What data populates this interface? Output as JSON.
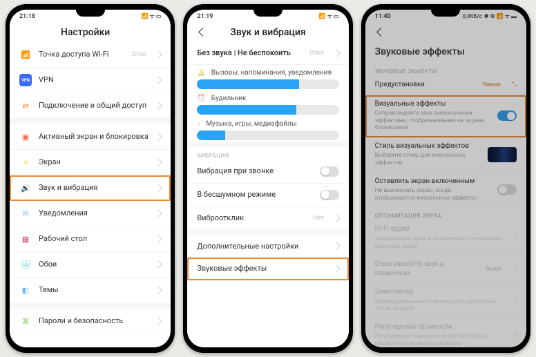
{
  "phone1": {
    "time": "21:18",
    "title": "Настройки",
    "items": [
      {
        "icon": "📶",
        "iconColor": "#f7b733",
        "label": "Точка доступа Wi-Fi",
        "value": "Откл"
      },
      {
        "icon": "VPN",
        "iconColor": "#3b6bff",
        "label": "VPN"
      },
      {
        "icon": "⇄",
        "iconColor": "#ff8c3b",
        "label": "Подключение и общий доступ"
      }
    ],
    "items2": [
      {
        "icon": "▣",
        "iconColor": "#ff6b4a",
        "label": "Активный экран и блокировка"
      },
      {
        "icon": "☀",
        "iconColor": "#ffd24a",
        "label": "Экран"
      },
      {
        "icon": "🔊",
        "iconColor": "#34c759",
        "label": "Звук и вибрация",
        "hl": true
      },
      {
        "icon": "✉",
        "iconColor": "#6ec4ff",
        "label": "Уведомления"
      },
      {
        "icon": "▦",
        "iconColor": "#c94a6a",
        "label": "Рабочий стол"
      },
      {
        "icon": "🖼",
        "iconColor": "#5ad1c8",
        "label": "Обои"
      },
      {
        "icon": "◧",
        "iconColor": "#6bb8ff",
        "label": "Темы"
      }
    ],
    "items3": [
      {
        "icon": "⌘",
        "iconColor": "#8ad16b",
        "label": "Пароли и безопасность"
      }
    ]
  },
  "phone2": {
    "time": "21:19",
    "title": "Звук и вибрация",
    "silentRow": {
      "label": "Без звука | Не беспокоить",
      "value": "Откл"
    },
    "sliders": [
      {
        "label": "Вызовы, напоминания, уведомления",
        "fill": 72
      },
      {
        "label": "Будильник",
        "fill": 70
      },
      {
        "label": "Музыка, игры, медиафайлы",
        "fill": 20
      }
    ],
    "vibHeader": "ВИБРАЦИЯ",
    "vibRows": [
      {
        "label": "Вибрация при звонке",
        "toggle": false
      },
      {
        "label": "В бесшумном режиме",
        "toggle": false
      },
      {
        "label": "Виброотклик",
        "value": "Нет"
      }
    ],
    "extra": [
      {
        "label": "Дополнительные настройки"
      },
      {
        "label": "Звуковые эффекты",
        "hl": true
      }
    ]
  },
  "phone3": {
    "time": "11:40",
    "statusRight": "0,0КБ/с",
    "title": "Звуковые эффекты",
    "sectHeader": "ЗВУКОВЫЕ ЭФФЕКТЫ",
    "preset": {
      "label": "Предустановка",
      "value": "Умная"
    },
    "visual": {
      "label": "Визуальные эффекты",
      "sub": "Сопровождайте звук визуальными эффектами, отображаемыми на экране блокировки",
      "hl": true,
      "toggle": true
    },
    "style": {
      "label": "Стиль визуальных эффектов",
      "sub": "Выберите стиль для визуальных эффектов"
    },
    "keepOn": {
      "label": "Оставлять экран включенным",
      "sub": "Не выключать экран, когда отображаются визуальные эффекты",
      "toggle": false
    },
    "optHeader": "ОПТИМИЗАЦИЯ ЗВУКА",
    "disabled": [
      {
        "label": "Hi-Fi аудио",
        "sub": "Уменьшение шума и искажений и повышение качества звука"
      },
      {
        "label": "Отрегулируйте звук в наушниках",
        "value": "Выкл"
      },
      {
        "label": "Эквалайзер",
        "sub": "Индивидуальные установки для различных типов музыки"
      },
      {
        "label": "Регулировка громкости",
        "sub": "Регулировка громкости в соответствии с вашим слуховым восприятием"
      }
    ]
  }
}
